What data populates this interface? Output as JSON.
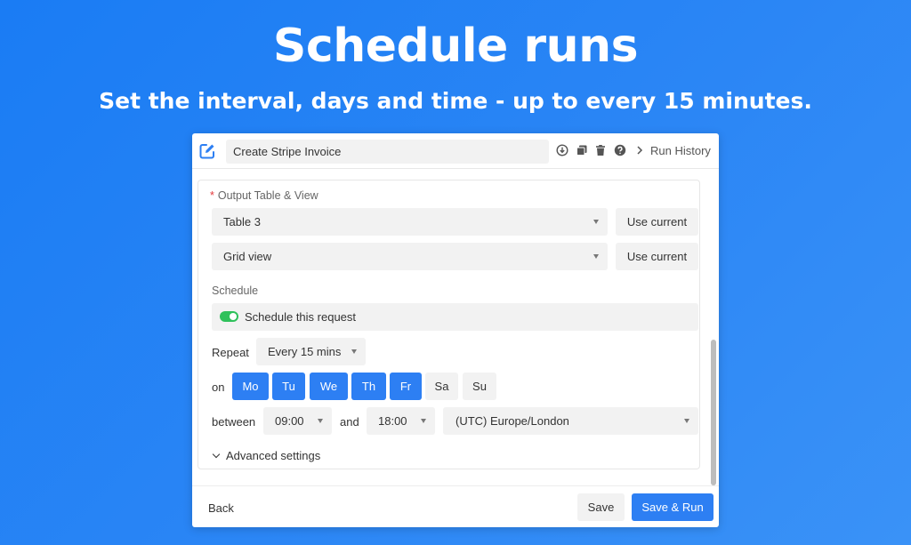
{
  "hero": {
    "title": "Schedule runs",
    "subtitle": "Set the interval, days and time - up to every 15 minutes."
  },
  "topbar": {
    "request_name": "Create Stripe Invoice",
    "icons": [
      "edit-icon",
      "download-icon",
      "duplicate-icon",
      "trash-icon",
      "help-icon",
      "chevron-right-icon"
    ],
    "run_history": "Run History"
  },
  "output": {
    "label": "Output Table & View",
    "required_marker": "*",
    "table_value": "Table 3",
    "view_value": "Grid view",
    "use_current_label": "Use current"
  },
  "schedule": {
    "label": "Schedule",
    "toggle_label": "Schedule this request",
    "toggle_on": true,
    "repeat_label": "Repeat",
    "repeat_value": "Every 15 mins",
    "on_label": "on",
    "days": [
      {
        "label": "Mo",
        "selected": true
      },
      {
        "label": "Tu",
        "selected": true
      },
      {
        "label": "We",
        "selected": true
      },
      {
        "label": "Th",
        "selected": true
      },
      {
        "label": "Fr",
        "selected": true
      },
      {
        "label": "Sa",
        "selected": false
      },
      {
        "label": "Su",
        "selected": false
      }
    ],
    "between_label": "between",
    "start_time": "09:00",
    "and_label": "and",
    "end_time": "18:00",
    "timezone": "(UTC) Europe/London",
    "advanced_label": "Advanced settings"
  },
  "footer": {
    "back_label": "Back",
    "save_label": "Save",
    "save_run_label": "Save & Run"
  },
  "colors": {
    "background": "#1a7cf4",
    "accent": "#2d7ff3",
    "toggle": "#2fc15b",
    "required": "#e4393c"
  }
}
